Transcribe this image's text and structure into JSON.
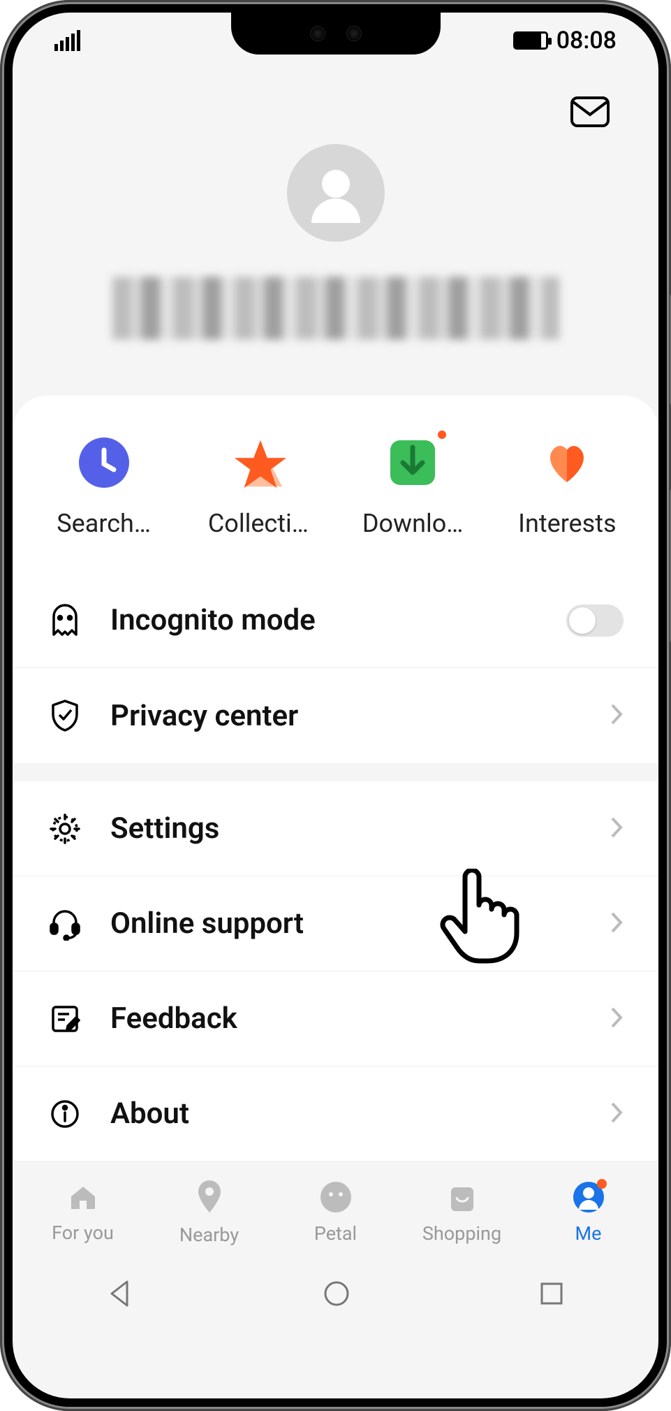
{
  "status": {
    "time": "08:08"
  },
  "quick_actions": [
    {
      "label": "Search…",
      "icon": "clock"
    },
    {
      "label": "Collecti…",
      "icon": "star"
    },
    {
      "label": "Downlo…",
      "icon": "download",
      "badge": true
    },
    {
      "label": "Interests",
      "icon": "heart"
    }
  ],
  "menu_group1": [
    {
      "label": "Incognito mode",
      "icon": "ghost",
      "control": "toggle",
      "toggled": false
    },
    {
      "label": "Privacy center",
      "icon": "shield-check",
      "control": "chevron"
    }
  ],
  "menu_group2": [
    {
      "label": "Settings",
      "icon": "gear",
      "control": "chevron"
    },
    {
      "label": "Online support",
      "icon": "headset",
      "control": "chevron"
    },
    {
      "label": "Feedback",
      "icon": "note-edit",
      "control": "chevron"
    },
    {
      "label": "About",
      "icon": "info",
      "control": "chevron"
    }
  ],
  "bottom_nav": [
    {
      "label": "For you",
      "icon": "home",
      "active": false
    },
    {
      "label": "Nearby",
      "icon": "pin",
      "active": false
    },
    {
      "label": "Petal",
      "icon": "face",
      "active": false
    },
    {
      "label": "Shopping",
      "icon": "bag",
      "active": false
    },
    {
      "label": "Me",
      "icon": "person",
      "active": true,
      "badge": true
    }
  ]
}
